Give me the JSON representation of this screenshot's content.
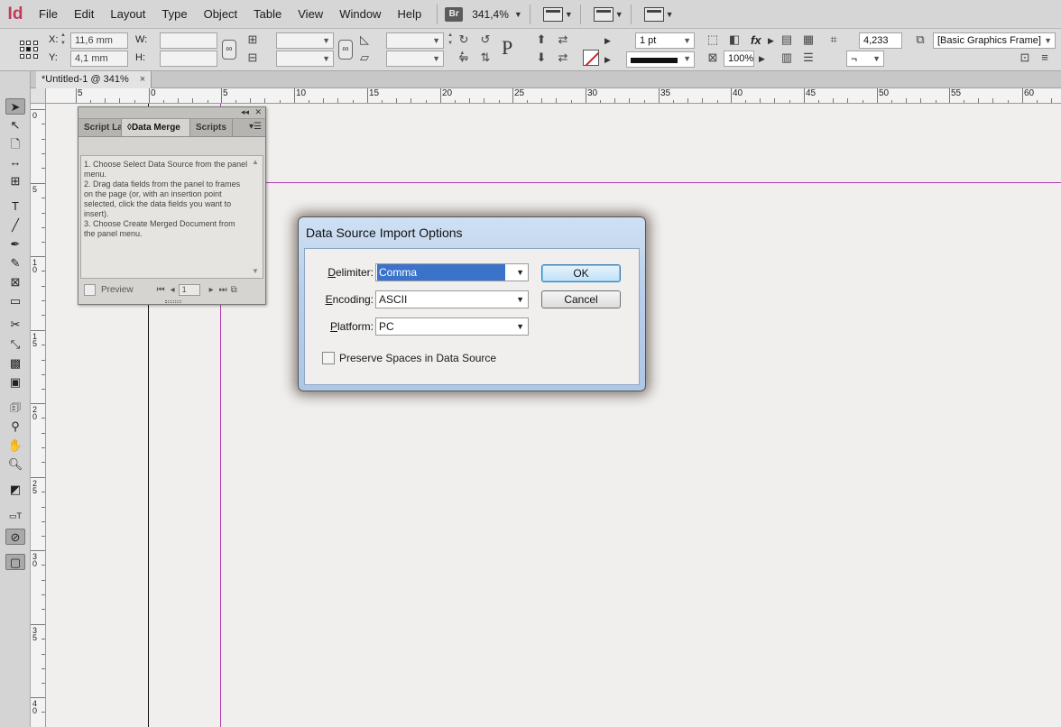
{
  "app": {
    "logo": "Id"
  },
  "menu": {
    "items": [
      "File",
      "Edit",
      "Layout",
      "Type",
      "Object",
      "Table",
      "View",
      "Window",
      "Help"
    ]
  },
  "menubar_right": {
    "bridge_label": "Br",
    "zoom": "341,4%"
  },
  "control": {
    "x_label": "X:",
    "x_value": "11,6 mm",
    "y_label": "Y:",
    "y_value": "4,1 mm",
    "w_label": "W:",
    "w_value": "",
    "h_label": "H:",
    "h_value": "",
    "stroke_weight": "1 pt",
    "scale_percent": "100%",
    "frame_size": "4,233 mm",
    "object_style": "[Basic Graphics Frame]",
    "fx_label": "fx"
  },
  "document_tab": {
    "title": "*Untitled-1 @ 341%",
    "close": "×"
  },
  "ruler_h": [
    "5",
    "0",
    "5",
    "10",
    "15",
    "20",
    "25",
    "30",
    "35",
    "40",
    "45",
    "50",
    "55",
    "60"
  ],
  "ruler_v": [
    "0",
    "5",
    "10",
    "15",
    "20",
    "25",
    "30",
    "35",
    "40"
  ],
  "panel": {
    "tabs": [
      "Script La",
      "Data Merge",
      "Scripts"
    ],
    "instructions": "1. Choose Select Data Source from the panel menu.\n2. Drag data fields from the panel to frames on the page (or, with an insertion point selected, click the data fields you want to insert).\n3. Choose Create Merged Document from the panel menu.",
    "preview_label": "Preview",
    "page_number": "1"
  },
  "dialog": {
    "title": "Data Source Import Options",
    "delimiter_label": "Delimiter:",
    "delimiter_value": "Comma",
    "encoding_label": "Encoding:",
    "encoding_value": "ASCII",
    "platform_label": "Platform:",
    "platform_value": "PC",
    "preserve_label": "Preserve Spaces in Data Source",
    "preserve_checked": false,
    "ok_label": "OK",
    "cancel_label": "Cancel"
  },
  "colors": {
    "accent": "#3a73c9",
    "guide": "#b13ab3",
    "logo": "#c23a5a"
  }
}
